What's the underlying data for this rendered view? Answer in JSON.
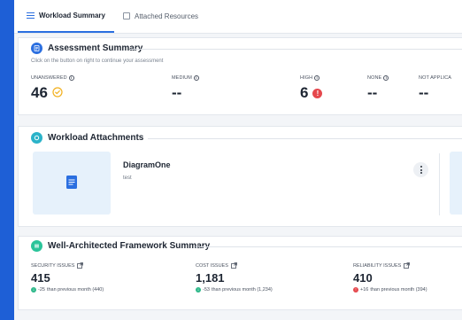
{
  "tabs": [
    {
      "label": "Workload Summary",
      "icon": "list-icon",
      "active": true
    },
    {
      "label": "Attached Resources",
      "icon": "box-icon",
      "active": false
    }
  ],
  "assessment": {
    "title": "Assessment Summary",
    "subtitle": "Click on the button on right to continue your assessment",
    "metrics": [
      {
        "label": "UNANSWERED",
        "value": "46",
        "badge": "pending-icon"
      },
      {
        "label": "MEDIUM",
        "value": "--"
      },
      {
        "label": "HIGH",
        "value": "6",
        "badge": "alert-icon"
      },
      {
        "label": "NONE",
        "value": "--"
      },
      {
        "label": "NOT APPLICA",
        "value": "--"
      }
    ]
  },
  "attachments": {
    "title": "Workload Attachments",
    "items": [
      {
        "name": "DiagramOne",
        "description": "test"
      }
    ]
  },
  "framework": {
    "title": "Well-Architected Framework Summary",
    "issues": [
      {
        "label": "SECURITY ISSUES",
        "value": "415",
        "trend_delta": "-25",
        "trend_text": "than previous month (440)",
        "direction": "down"
      },
      {
        "label": "COST ISSUES",
        "value": "1,181",
        "trend_delta": "-53",
        "trend_text": "than previous month (1,234)",
        "direction": "down"
      },
      {
        "label": "RELIABILITY ISSUES",
        "value": "410",
        "trend_delta": "+16",
        "trend_text": "than previous month (394)",
        "direction": "up"
      }
    ]
  },
  "colors": {
    "primary": "#2b6fe0",
    "positive": "#2eb88a",
    "negative": "#e5484d",
    "pending": "#f2b01e",
    "outer_bg": "#1e5fd6"
  }
}
